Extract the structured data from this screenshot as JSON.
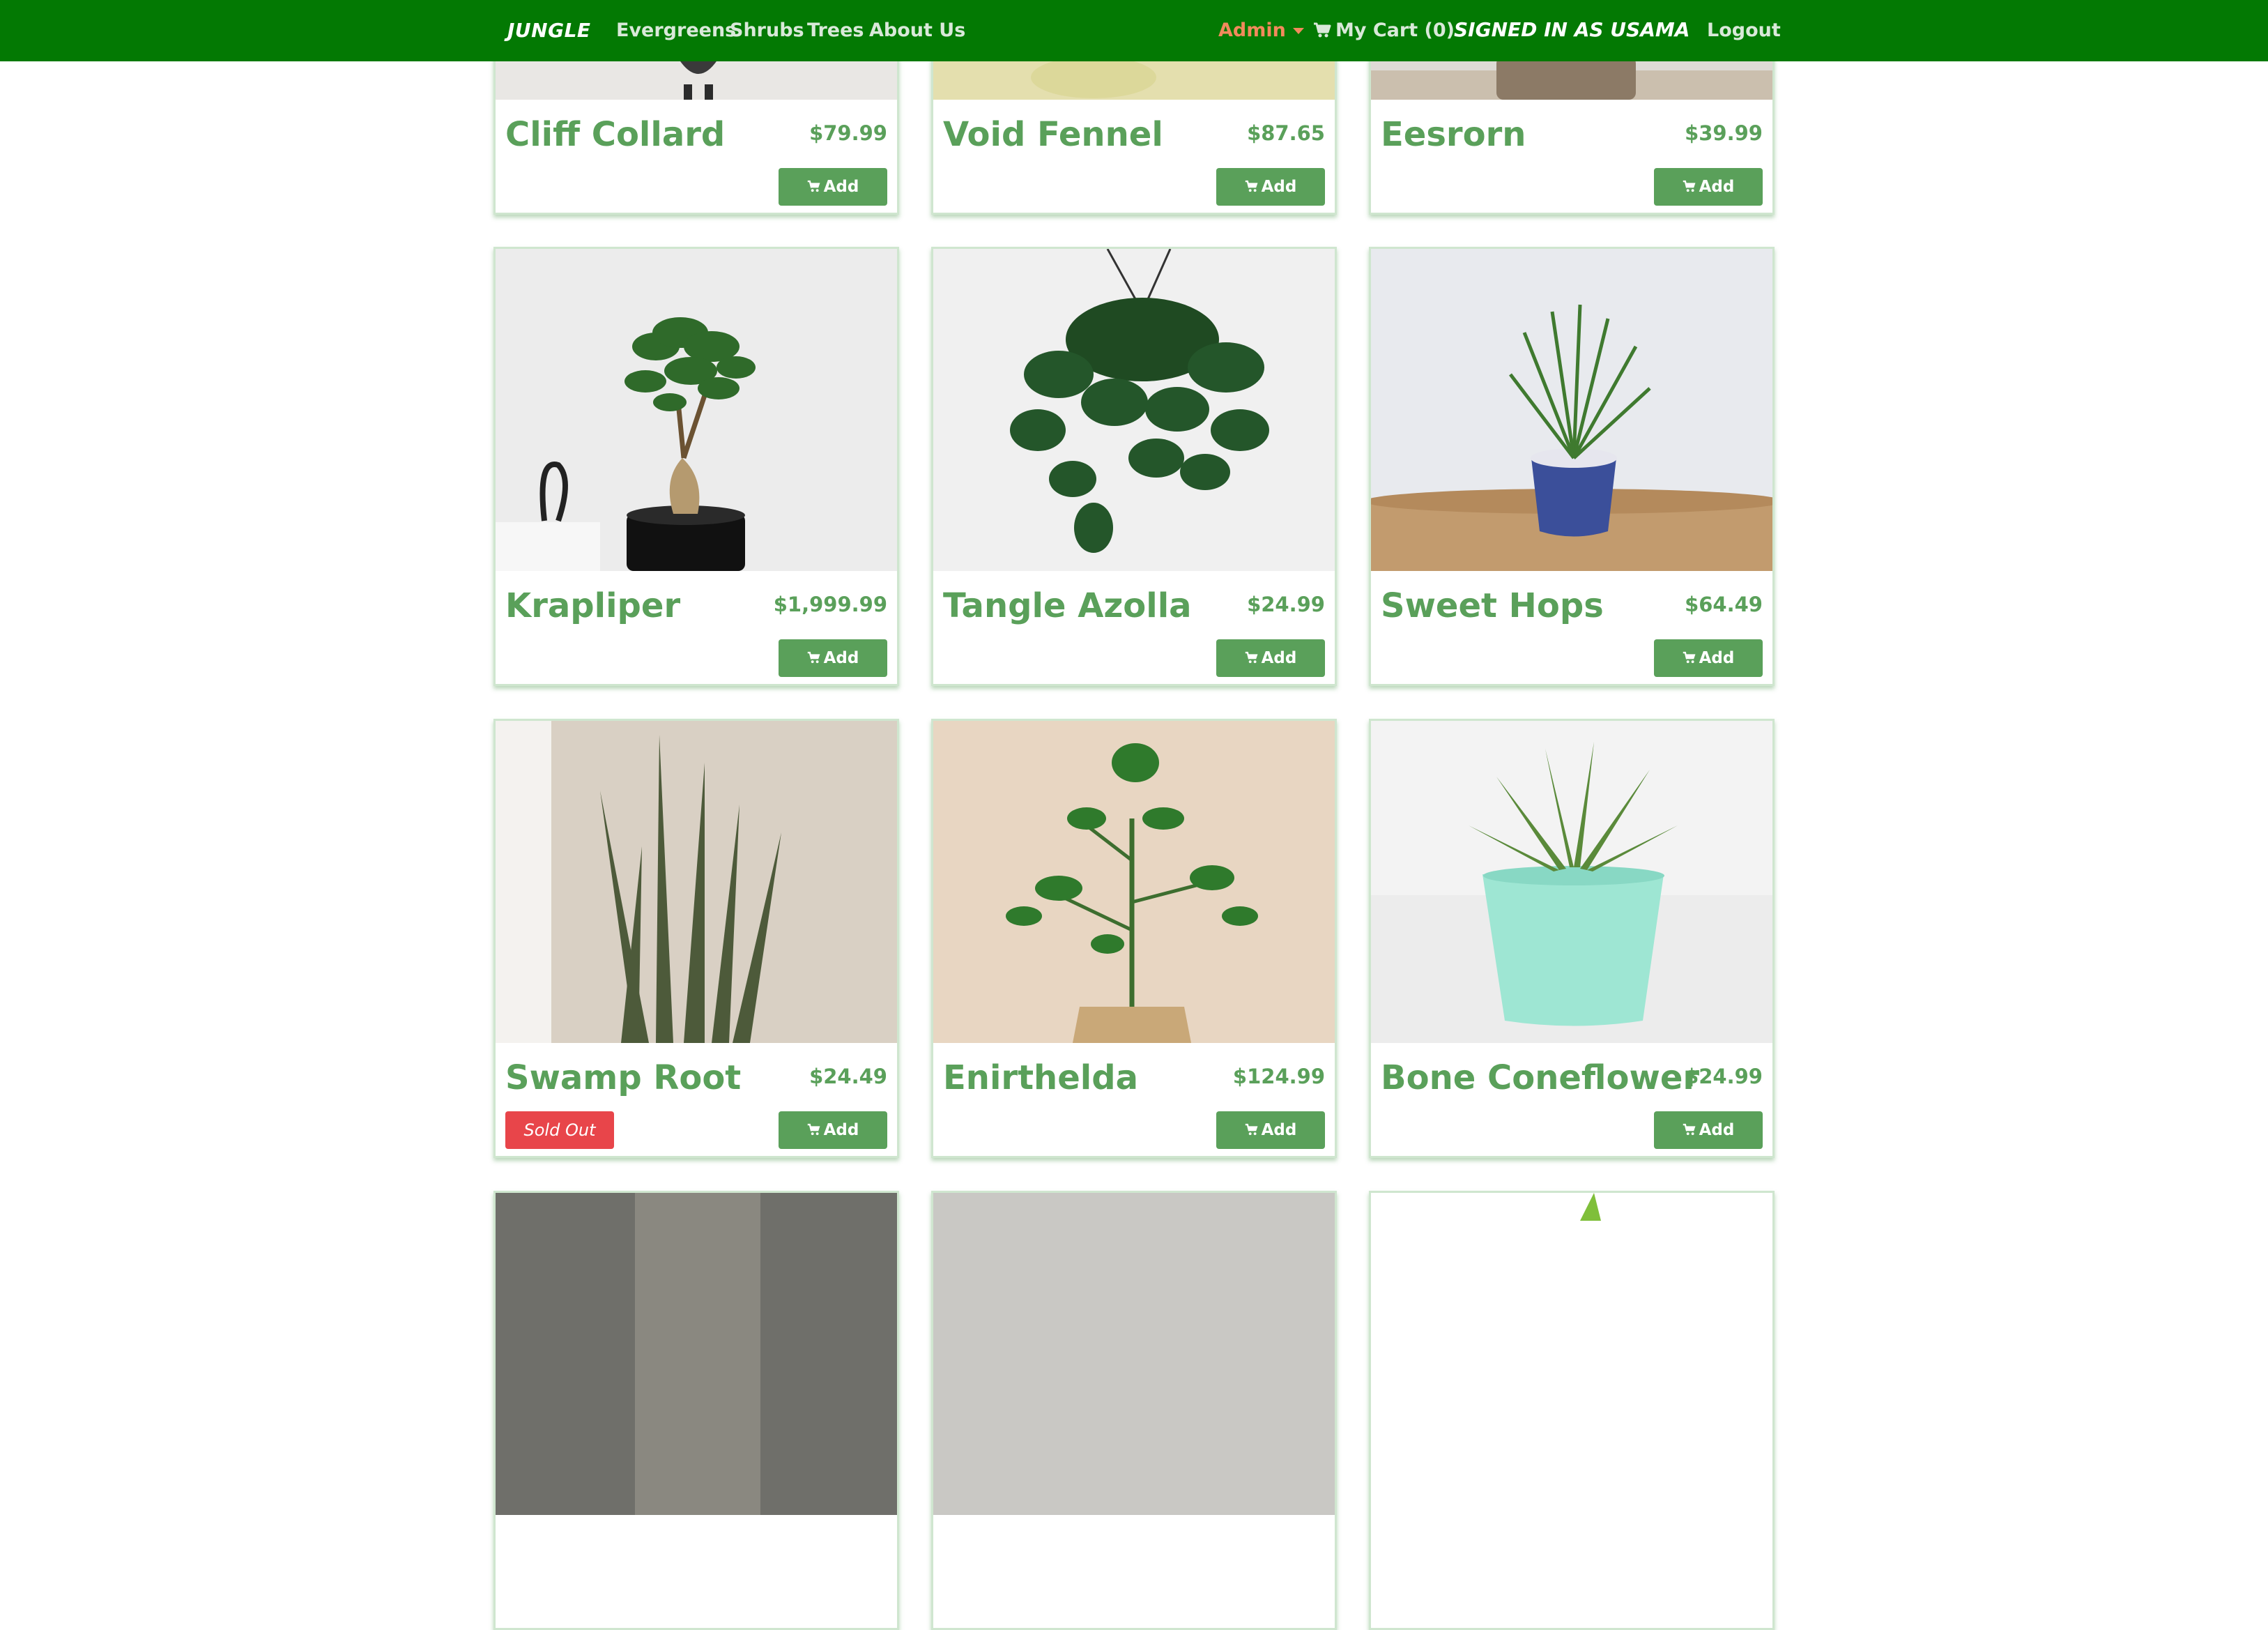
{
  "navbar": {
    "brand": "JUNGLE",
    "links": [
      "Evergreens",
      "Shrubs",
      "Trees",
      "About Us"
    ],
    "admin_label": "Admin",
    "cart_label": "My Cart (0)",
    "signed_in": "SIGNED IN AS USAMA",
    "logout_label": "Logout"
  },
  "colors": {
    "navbar_bg": "#037903",
    "accent_green": "#5aa05a",
    "admin_orange": "#f28a5c",
    "sold_out_red": "#e8454a"
  },
  "products": [
    {
      "name": "Cliff Collard",
      "price": "$79.99",
      "add_label": "Add"
    },
    {
      "name": "Void Fennel",
      "price": "$87.65",
      "add_label": "Add"
    },
    {
      "name": "Eesrorn",
      "price": "$39.99",
      "add_label": "Add"
    },
    {
      "name": "Krapliper",
      "price": "$1,999.99",
      "add_label": "Add"
    },
    {
      "name": "Tangle Azolla",
      "price": "$24.99",
      "add_label": "Add"
    },
    {
      "name": "Sweet Hops",
      "price": "$64.49",
      "add_label": "Add"
    },
    {
      "name": "Swamp Root",
      "price": "$24.49",
      "add_label": "Add",
      "badge": "Sold Out"
    },
    {
      "name": "Enirthelda",
      "price": "$124.99",
      "add_label": "Add"
    },
    {
      "name": "Bone Coneflower",
      "price": "$24.99",
      "add_label": "Add"
    }
  ]
}
